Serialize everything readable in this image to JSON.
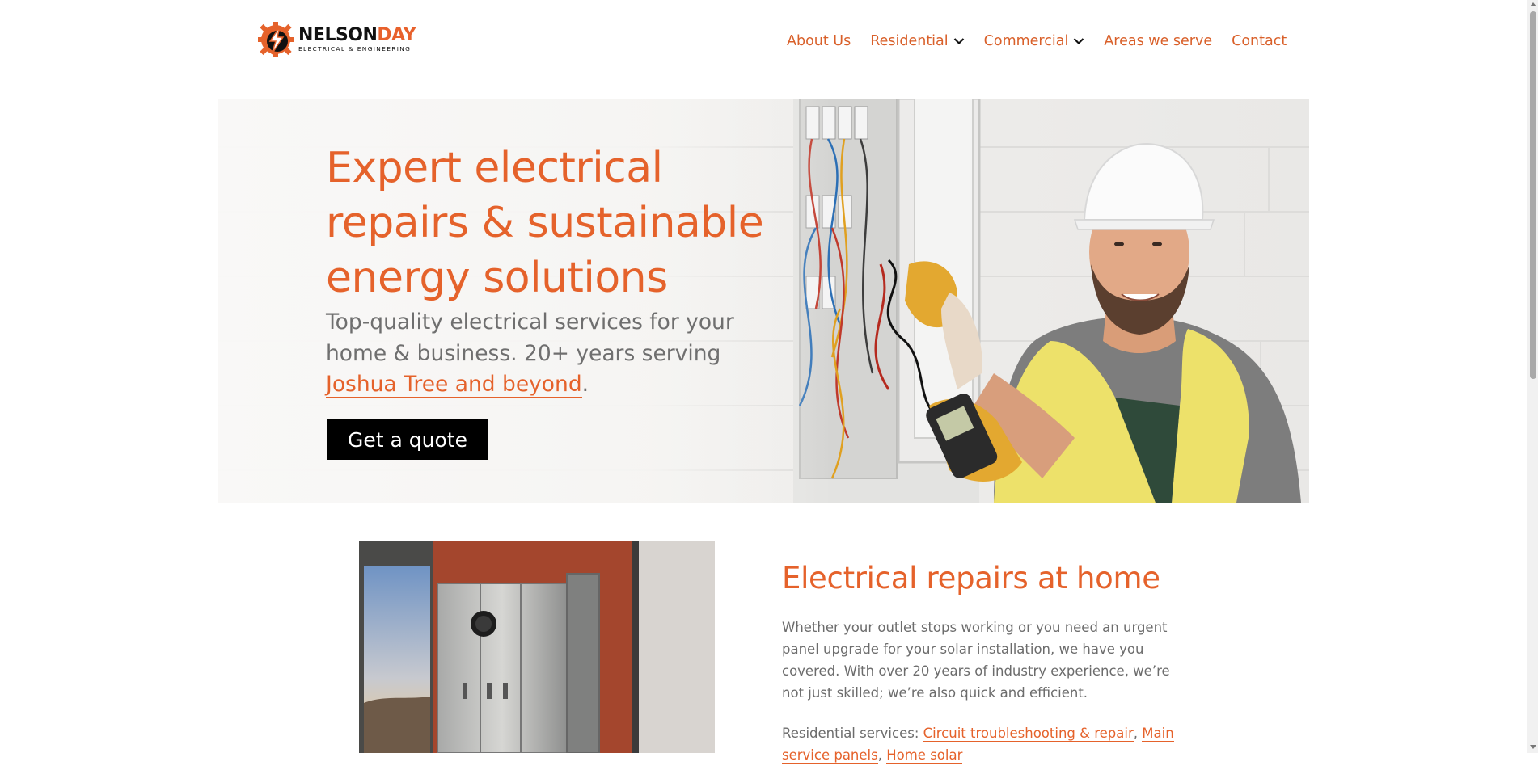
{
  "brand": {
    "name_primary": "NELSON",
    "name_accent": "DAY",
    "tagline": "ELECTRICAL & ENGINEERING",
    "accent_color": "#e5622b"
  },
  "nav": {
    "about": "About Us",
    "residential": "Residential",
    "commercial": "Commercial",
    "areas": "Areas we serve",
    "contact": "Contact"
  },
  "hero": {
    "title": "Expert electrical repairs & sustainable energy solutions",
    "subtitle": "Top-quality electrical services for your home & business. 20+ years serving ",
    "subtitle_link": "Joshua Tree and beyond",
    "subtitle_end": ".",
    "cta": "Get a quote"
  },
  "repairs": {
    "title": "Electrical repairs at home",
    "body": "Whether your outlet stops working or you need an urgent panel upgrade for your solar installation, we have you covered. With over 20 years of industry experience, we’re not just skilled; we’re also quick and efficient.",
    "services_label": "Residential services: ",
    "services": [
      "Circuit troubleshooting & repair",
      "Main service panels",
      "Home solar"
    ],
    "separator": ", "
  },
  "icons": {
    "logo": "bolt-gear-icon",
    "dropdown": "chevron-down-icon"
  }
}
